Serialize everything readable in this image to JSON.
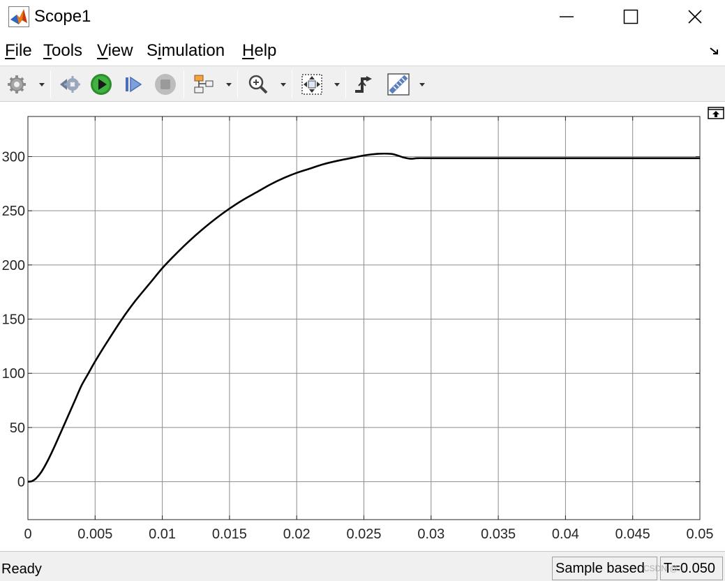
{
  "window": {
    "title": "Scope1",
    "app_icon": "matlab-logo-icon",
    "controls": [
      "minimize-icon",
      "maximize-icon",
      "close-icon"
    ]
  },
  "menu": {
    "items": [
      {
        "label": "File",
        "mnemonic": "F",
        "rest": "ile"
      },
      {
        "label": "Tools",
        "mnemonic": "T",
        "rest": "ools"
      },
      {
        "label": "View",
        "mnemonic": "V",
        "rest": "iew"
      },
      {
        "label": "Simulation",
        "mnemonic": "i",
        "pre": "S",
        "rest": "mulation"
      },
      {
        "label": "Help",
        "mnemonic": "H",
        "rest": "elp"
      }
    ],
    "undock_icon": "undock-arrow-icon"
  },
  "toolbar": {
    "buttons": [
      "settings-gear-icon",
      "step-back-icon",
      "run-icon",
      "step-forward-icon",
      "stop-icon",
      "signal-selector-icon",
      "zoom-in-icon",
      "autoscale-icon",
      "triggers-icon",
      "cursor-measurements-icon"
    ]
  },
  "chart_data": {
    "type": "line",
    "title": "",
    "xlabel": "",
    "ylabel": "",
    "xlim": [
      0,
      0.05
    ],
    "ylim": [
      -35,
      337
    ],
    "grid": true,
    "xticks": [
      0,
      0.005,
      0.01,
      0.015,
      0.02,
      0.025,
      0.03,
      0.035,
      0.04,
      0.045,
      0.05
    ],
    "xtick_labels": [
      "0",
      "0.005",
      "0.01",
      "0.015",
      "0.02",
      "0.025",
      "0.03",
      "0.035",
      "0.04",
      "0.045",
      "0.05"
    ],
    "yticks": [
      0,
      50,
      100,
      150,
      200,
      250,
      300
    ],
    "ytick_labels": [
      "0",
      "50",
      "100",
      "150",
      "200",
      "250",
      "300"
    ],
    "series": [
      {
        "color": "#000000",
        "x": [
          0,
          0.0003,
          0.0006,
          0.001,
          0.0015,
          0.002,
          0.0025,
          0.003,
          0.0035,
          0.004,
          0.0045,
          0.005,
          0.006,
          0.007,
          0.008,
          0.009,
          0.01,
          0.011,
          0.012,
          0.013,
          0.014,
          0.015,
          0.016,
          0.017,
          0.018,
          0.019,
          0.02,
          0.021,
          0.022,
          0.023,
          0.024,
          0.025,
          0.026,
          0.027,
          0.0275,
          0.028,
          0.0285,
          0.029,
          0.03,
          0.035,
          0.04,
          0.045,
          0.05
        ],
        "y": [
          0,
          0.5,
          3,
          9,
          20,
          33,
          47,
          61,
          75,
          89,
          100,
          111,
          131,
          150,
          167,
          182,
          197,
          210,
          222,
          233,
          243,
          252,
          260,
          267,
          274,
          280,
          285,
          289,
          293,
          296,
          298.5,
          301,
          302.5,
          302.5,
          301,
          299,
          298,
          298.5,
          298.5,
          298.5,
          298.5,
          298.5,
          298.5
        ]
      }
    ]
  },
  "plot": {
    "restore_icon": "restore-layout-icon"
  },
  "status": {
    "ready": "Ready",
    "sample": "Sample based",
    "time": "T=0.050"
  },
  "watermark": "CSDN @..."
}
